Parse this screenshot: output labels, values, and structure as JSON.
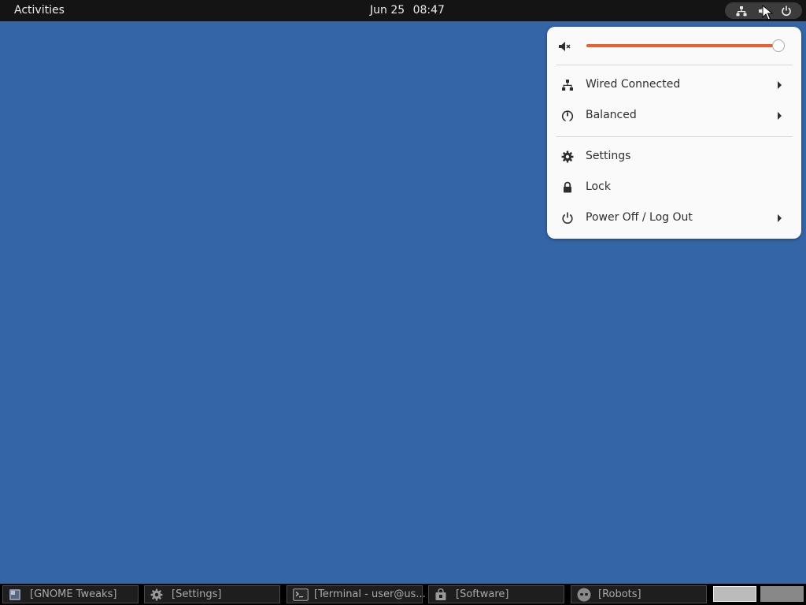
{
  "topbar": {
    "activities_label": "Activities",
    "date": "Jun 25",
    "time": "08:47",
    "tray_icons": [
      "network-wired-icon",
      "volume-muted-icon",
      "power-icon"
    ]
  },
  "system_menu": {
    "volume": {
      "icon": "volume-muted-icon",
      "level_percent": 100,
      "accent_color": "#e8602c"
    },
    "items": [
      {
        "icon": "network-wired-icon",
        "label": "Wired Connected",
        "submenu": true
      },
      {
        "icon": "power-profile-icon",
        "label": "Balanced",
        "submenu": true
      },
      {
        "icon": "gear-icon",
        "label": "Settings",
        "submenu": false
      },
      {
        "icon": "lock-icon",
        "label": "Lock",
        "submenu": false
      },
      {
        "icon": "power-icon",
        "label": "Power Off / Log Out",
        "submenu": true
      }
    ]
  },
  "taskbar": {
    "windows": [
      {
        "icon": "tweaks-icon",
        "label": "[GNOME Tweaks]"
      },
      {
        "icon": "gear-icon",
        "label": "[Settings]"
      },
      {
        "icon": "terminal-icon",
        "label": "[Terminal - user@us..."
      },
      {
        "icon": "software-bag-icon",
        "label": "[Software]"
      },
      {
        "icon": "robots-icon",
        "label": "[Robots]"
      }
    ],
    "workspaces": 2,
    "active_workspace": 1
  },
  "colors": {
    "desktop": "#3465a7",
    "topbar": "#141414",
    "menu_bg": "#fafafa"
  }
}
